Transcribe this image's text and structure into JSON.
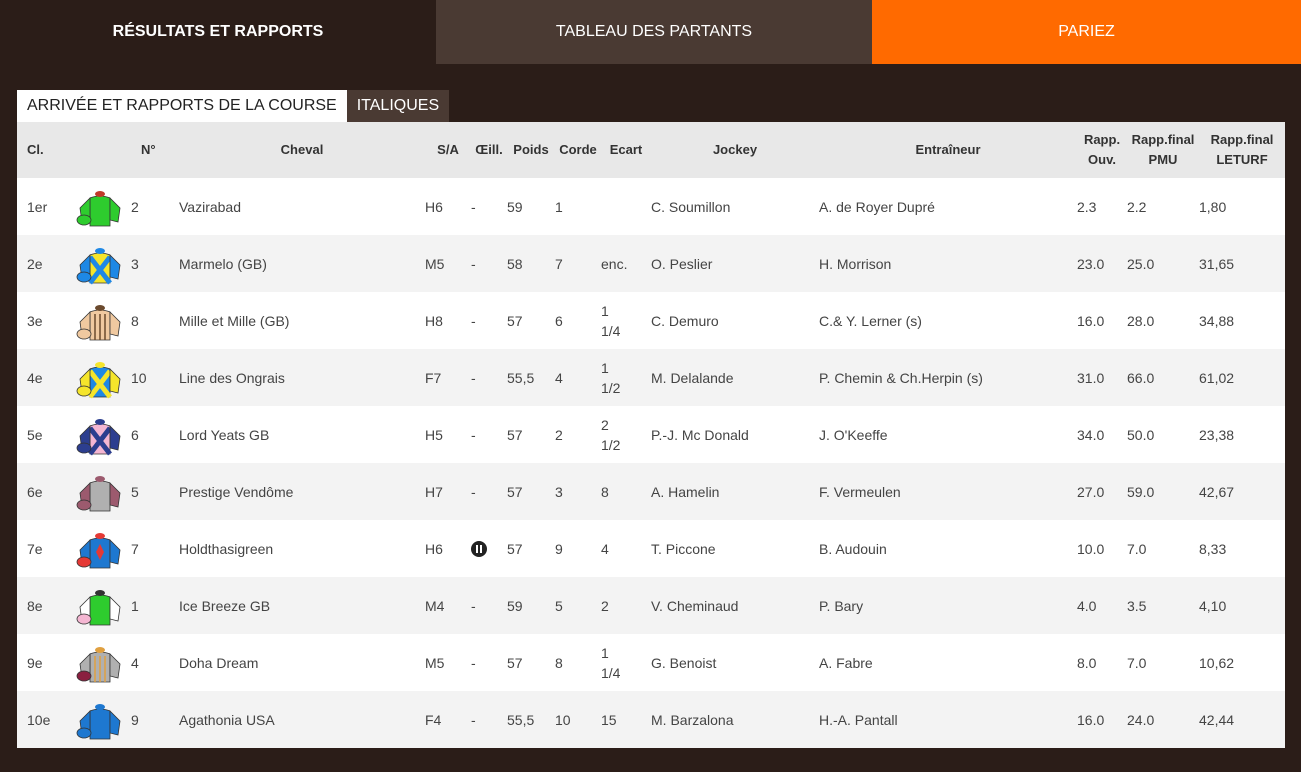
{
  "nav": {
    "tabs": [
      {
        "label": "RÉSULTATS ET RAPPORTS"
      },
      {
        "label": "TABLEAU DES PARTANTS"
      },
      {
        "label": "PARIEZ"
      }
    ]
  },
  "subtabs": [
    {
      "label": "ARRIVÉE ET RAPPORTS DE LA COURSE"
    },
    {
      "label": "ITALIQUES"
    }
  ],
  "table": {
    "headers": {
      "cl": "Cl.",
      "num": "N°",
      "cheval": "Cheval",
      "sa": "S/A",
      "oeil": "Œill.",
      "poids": "Poids",
      "corde": "Corde",
      "ecart": "Ecart",
      "jockey": "Jockey",
      "entraineur": "Entraîneur",
      "rapp_ouv_1": "Rapp.",
      "rapp_ouv_2": "Ouv.",
      "rapp_pmu_1": "Rapp.final",
      "rapp_pmu_2": "PMU",
      "rapp_leturf_1": "Rapp.final",
      "rapp_leturf_2": "LETURF"
    },
    "rows": [
      {
        "cl": "1er",
        "num": "2",
        "cheval": "Vazirabad",
        "sa": "H6",
        "oeil": "-",
        "poids": "59",
        "corde": "1",
        "ecart1": "",
        "ecart2": "",
        "jockey": "C. Soumillon",
        "entraineur": "A. de Royer Dupré",
        "ouv": "2.3",
        "pmu": "2.2",
        "leturf": "1,80",
        "silk": {
          "body": "#2ecc2e",
          "sleeve": "#2ecc2e",
          "accent": "#c0392b",
          "cap": "#2ecc2e",
          "pattern": "plain"
        }
      },
      {
        "cl": "2e",
        "num": "3",
        "cheval": "Marmelo (GB)",
        "sa": "M5",
        "oeil": "-",
        "poids": "58",
        "corde": "7",
        "ecart1": "enc.",
        "ecart2": "",
        "jockey": "O. Peslier",
        "entraineur": "H. Morrison",
        "ouv": "23.0",
        "pmu": "25.0",
        "leturf": "31,65",
        "silk": {
          "body": "#f5e52b",
          "sleeve": "#1e88e5",
          "accent": "#1e88e5",
          "cap": "#1e88e5",
          "pattern": "cross"
        }
      },
      {
        "cl": "3e",
        "num": "8",
        "cheval": "Mille et Mille (GB)",
        "sa": "H8",
        "oeil": "-",
        "poids": "57",
        "corde": "6",
        "ecart1": "1",
        "ecart2": "1/4",
        "jockey": "C. Demuro",
        "entraineur": "C.& Y. Lerner (s)",
        "ouv": "16.0",
        "pmu": "28.0",
        "leturf": "34,88",
        "silk": {
          "body": "#f0c9a0",
          "sleeve": "#f0c9a0",
          "accent": "#6b4a2e",
          "cap": "#f0c9a0",
          "pattern": "stripes"
        }
      },
      {
        "cl": "4e",
        "num": "10",
        "cheval": "Line des Ongrais",
        "sa": "F7",
        "oeil": "-",
        "poids": "55,5",
        "corde": "4",
        "ecart1": "1",
        "ecart2": "1/2",
        "jockey": "M. Delalande",
        "entraineur": "P. Chemin & Ch.Herpin (s)",
        "ouv": "31.0",
        "pmu": "66.0",
        "leturf": "61,02",
        "silk": {
          "body": "#1e88e5",
          "sleeve": "#f5e52b",
          "accent": "#f5e52b",
          "cap": "#f5e52b",
          "pattern": "cross"
        }
      },
      {
        "cl": "5e",
        "num": "6",
        "cheval": "Lord Yeats GB",
        "sa": "H5",
        "oeil": "-",
        "poids": "57",
        "corde": "2",
        "ecart1": "2",
        "ecart2": "1/2",
        "jockey": "P.-J. Mc Donald",
        "entraineur": "J. O'Keeffe",
        "ouv": "34.0",
        "pmu": "50.0",
        "leturf": "23,38",
        "silk": {
          "body": "#f4b6d2",
          "sleeve": "#2c3e8f",
          "accent": "#2c3e8f",
          "cap": "#2c3e8f",
          "pattern": "cross"
        }
      },
      {
        "cl": "6e",
        "num": "5",
        "cheval": "Prestige Vendôme",
        "sa": "H7",
        "oeil": "-",
        "poids": "57",
        "corde": "3",
        "ecart1": "8",
        "ecart2": "",
        "jockey": "A. Hamelin",
        "entraineur": "F. Vermeulen",
        "ouv": "27.0",
        "pmu": "59.0",
        "leturf": "42,67",
        "silk": {
          "body": "#b0b0b0",
          "sleeve": "#9c5a6e",
          "accent": "#9c5a6e",
          "cap": "#9c5a6e",
          "pattern": "plain"
        }
      },
      {
        "cl": "7e",
        "num": "7",
        "cheval": "Holdthasigreen",
        "sa": "H6",
        "oeil": "icon",
        "poids": "57",
        "corde": "9",
        "ecart1": "4",
        "ecart2": "",
        "jockey": "T. Piccone",
        "entraineur": "B. Audouin",
        "ouv": "10.0",
        "pmu": "7.0",
        "leturf": "8,33",
        "silk": {
          "body": "#1e78d0",
          "sleeve": "#1e78d0",
          "accent": "#e53935",
          "cap": "#e53935",
          "pattern": "diamond"
        }
      },
      {
        "cl": "8e",
        "num": "1",
        "cheval": "Ice Breeze GB",
        "sa": "M4",
        "oeil": "-",
        "poids": "59",
        "corde": "5",
        "ecart1": "2",
        "ecart2": "",
        "jockey": "V. Cheminaud",
        "entraineur": "P. Bary",
        "ouv": "4.0",
        "pmu": "3.5",
        "leturf": "4,10",
        "silk": {
          "body": "#2ecc2e",
          "sleeve": "#ffffff",
          "accent": "#333333",
          "cap": "#f4b6d2",
          "pattern": "plain"
        }
      },
      {
        "cl": "9e",
        "num": "4",
        "cheval": "Doha Dream",
        "sa": "M5",
        "oeil": "-",
        "poids": "57",
        "corde": "8",
        "ecart1": "1",
        "ecart2": "1/4",
        "jockey": "G. Benoist",
        "entraineur": "A. Fabre",
        "ouv": "8.0",
        "pmu": "7.0",
        "leturf": "10,62",
        "silk": {
          "body": "#b0b0b0",
          "sleeve": "#b0b0b0",
          "accent": "#e0a040",
          "cap": "#8a2040",
          "pattern": "stripes"
        }
      },
      {
        "cl": "10e",
        "num": "9",
        "cheval": "Agathonia USA",
        "sa": "F4",
        "oeil": "-",
        "poids": "55,5",
        "corde": "10",
        "ecart1": "15",
        "ecart2": "",
        "jockey": "M. Barzalona",
        "entraineur": "H.-A. Pantall",
        "ouv": "16.0",
        "pmu": "24.0",
        "leturf": "42,44",
        "silk": {
          "body": "#1e78d0",
          "sleeve": "#1e78d0",
          "accent": "#1e78d0",
          "cap": "#1e78d0",
          "pattern": "plain"
        }
      }
    ]
  }
}
